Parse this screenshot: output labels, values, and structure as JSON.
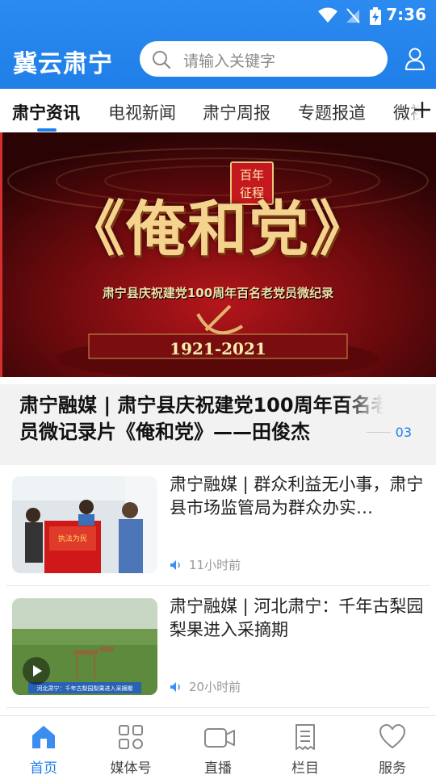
{
  "status": {
    "time": "7:36"
  },
  "header": {
    "brand": "冀云肃宁",
    "search_placeholder": "请输入关键字"
  },
  "tabs": [
    {
      "label": "肃宁资讯",
      "active": true
    },
    {
      "label": "电视新闻"
    },
    {
      "label": "肃宁周报"
    },
    {
      "label": "专题报道"
    },
    {
      "label": "微视"
    }
  ],
  "banner": {
    "badge_line1": "百年",
    "badge_line2": "征程",
    "big_title": "《俺和党》",
    "subtitle": "肃宁县庆祝建党100周年百名老党员微纪录",
    "years": "1921-2021",
    "caption": "肃宁融媒 | 肃宁县庆祝建党100周年百名老党员微记录片《俺和党》——田俊杰",
    "page": "03"
  },
  "news": [
    {
      "title": "肃宁融媒 | 群众利益无小事，肃宁县市场监管局为群众办实…",
      "time": "11小时前"
    },
    {
      "title": "肃宁融媒 | 河北肃宁：千年古梨园梨果进入采摘期",
      "time": "20小时前",
      "thumb_caption": "河北肃宁：千年古梨园梨果进入采摘期"
    }
  ],
  "bottomnav": [
    {
      "label": "首页",
      "active": true
    },
    {
      "label": "媒体号"
    },
    {
      "label": "直播"
    },
    {
      "label": "栏目"
    },
    {
      "label": "服务"
    }
  ],
  "colors": {
    "brand_blue": "#1f7fe8",
    "banner_red": "#8a1014"
  }
}
